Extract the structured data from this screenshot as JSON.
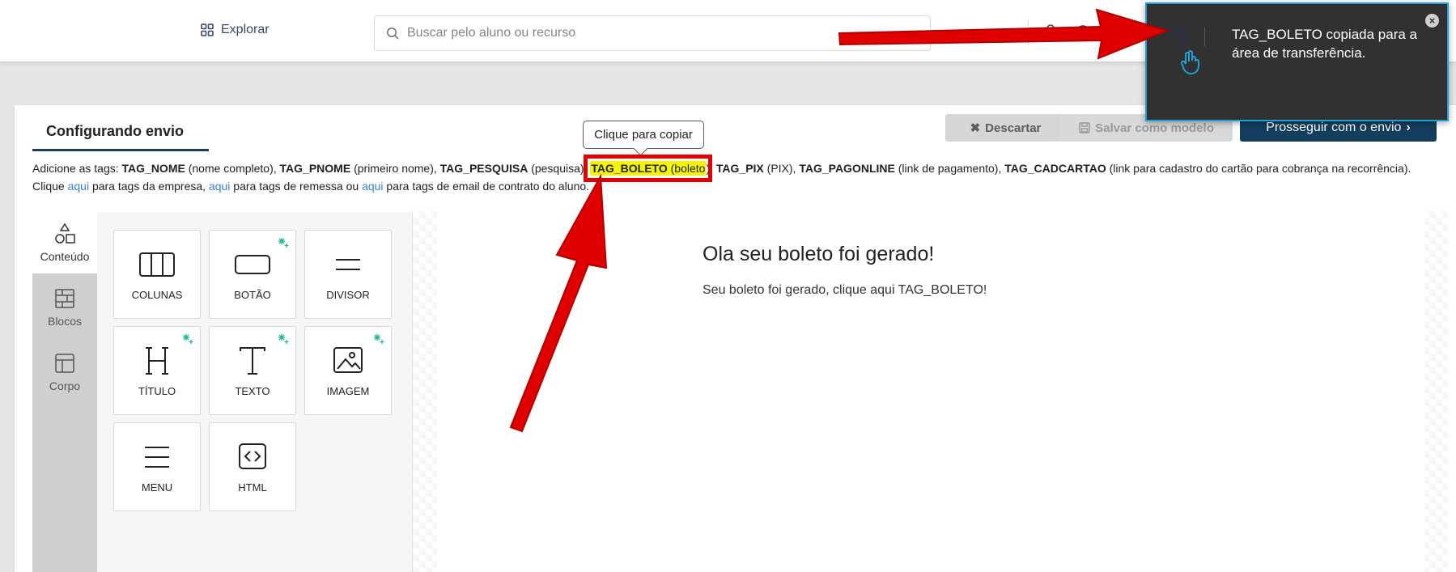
{
  "topbar": {
    "explore_label": "Explorar",
    "search_placeholder": "Buscar pelo aluno ou recurso"
  },
  "card": {
    "title": "Configurando envio",
    "buttons": {
      "discard": "Descartar",
      "save_model": "Salvar como modelo",
      "proceed": "Prosseguir com o envio"
    },
    "tooltip": "Clique para copiar",
    "tags_line": {
      "intro": "Adicione as tags: ",
      "tag_nome": "TAG_NOME",
      "tag_nome_desc": " (nome completo), ",
      "tag_pnome": "TAG_PNOME",
      "tag_pnome_desc": " (primeiro nome), ",
      "tag_pesquisa": "TAG_PESQUISA",
      "tag_pesquisa_desc": " (pesquisa), ",
      "tag_boleto": "TAG_BOLETO",
      "tag_boleto_desc": " (boleto",
      "tag_boleto_desc_after": "), ",
      "tag_pix": "TAG_PIX",
      "tag_pix_desc": " (PIX), ",
      "tag_pagonline": "TAG_PAGONLINE",
      "tag_pagonline_desc": " (link de pagamento), ",
      "tag_cadcartao": "TAG_CADCARTAO",
      "tag_cadcartao_desc": " (link para cadastro do cartão para cobrança na recorrência). Clique ",
      "link_here": "aqui",
      "company_tags": " para tags da empresa, ",
      "shipment_tags": " para tags de remessa ou ",
      "email_tags": " para tags de email de contrato do aluno."
    }
  },
  "rail": {
    "items": [
      {
        "label": "Conteúdo",
        "icon": "shapes-icon",
        "active": true
      },
      {
        "label": "Blocos",
        "icon": "blocks-icon",
        "active": false
      },
      {
        "label": "Corpo",
        "icon": "layout-icon",
        "active": false
      }
    ]
  },
  "blocks": [
    {
      "label": "COLUNAS",
      "icon": "columns-icon",
      "ai": false
    },
    {
      "label": "BOTÃO",
      "icon": "button-icon",
      "ai": true
    },
    {
      "label": "DIVISOR",
      "icon": "divider-icon",
      "ai": false
    },
    {
      "label": "TÍTULO",
      "icon": "heading-icon",
      "ai": true
    },
    {
      "label": "TEXTO",
      "icon": "text-icon",
      "ai": true
    },
    {
      "label": "IMAGEM",
      "icon": "image-icon",
      "ai": true
    },
    {
      "label": "MENU",
      "icon": "menu-icon",
      "ai": false
    },
    {
      "label": "HTML",
      "icon": "code-icon",
      "ai": false
    }
  ],
  "email_preview": {
    "title": "Ola seu boleto foi gerado!",
    "body": "Seu boleto foi gerado, clique aqui TAG_BOLETO!"
  },
  "toast": {
    "message": "TAG_BOLETO copiada para a área de transferência.",
    "close": "×"
  },
  "colors": {
    "primary": "#133e5e",
    "highlight": "#f5f500",
    "annotation_red": "#e10000",
    "toast_border": "#1ea0d9",
    "link": "#3b82d6"
  }
}
